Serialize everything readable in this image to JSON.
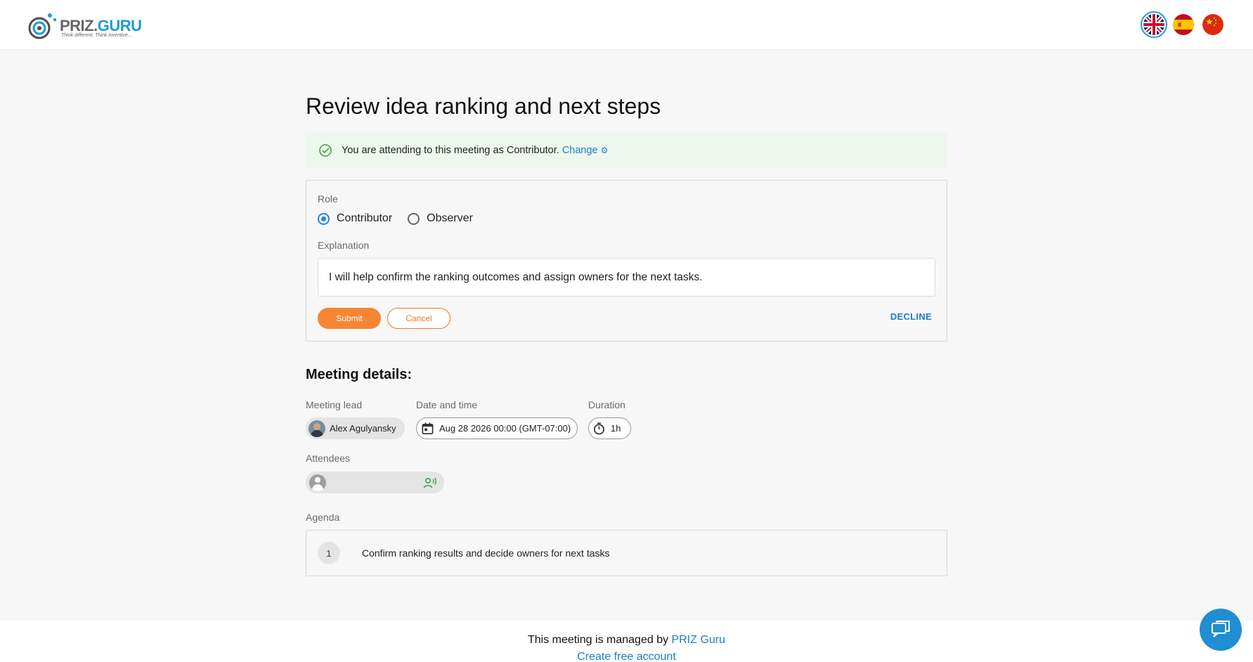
{
  "header": {
    "logo": {
      "word1": "PRIZ.",
      "word2": "GURU",
      "tagline": "Think different. Think inventive..."
    },
    "languages": [
      {
        "name": "English",
        "icon": "uk-flag-icon",
        "active": true
      },
      {
        "name": "Spanish",
        "icon": "spain-flag-icon",
        "active": false
      },
      {
        "name": "Chinese",
        "icon": "china-flag-icon",
        "active": false
      }
    ]
  },
  "meeting": {
    "title": "Review idea ranking and next steps",
    "notice": {
      "text": "You are attending to this meeting as Contributor.",
      "change_link": "Change",
      "color": "#eef7ee"
    },
    "role_form": {
      "role_label": "Role",
      "options": [
        {
          "label": "Contributor",
          "selected": true
        },
        {
          "label": "Observer",
          "selected": false
        }
      ],
      "explanation_label": "Explanation",
      "explanation_value": "I will help confirm the ranking outcomes and assign owners for the next tasks.",
      "submit_label": "Submit",
      "cancel_label": "Cancel",
      "decline_label": "DECLINE"
    },
    "details": {
      "section_title": "Meeting details:",
      "lead_label": "Meeting lead",
      "lead_name": "Alex Agulyansky",
      "date_label": "Date and time",
      "date_value": "Aug 28 2026 00:00 (GMT-07:00)",
      "duration_label": "Duration",
      "duration_value": "1h",
      "attendees_label": "Attendees",
      "agenda_label": "Agenda",
      "agenda_items": [
        {
          "number": "1",
          "text": "Confirm ranking results and decide owners for next tasks"
        }
      ]
    }
  },
  "footer": {
    "managed_text": "This meeting is managed by",
    "managed_link": "PRIZ Guru",
    "create_account": "Create free account"
  },
  "colors": {
    "accent": "#f58634",
    "link": "#1a7fc4",
    "chat": "#1f8ed2"
  }
}
